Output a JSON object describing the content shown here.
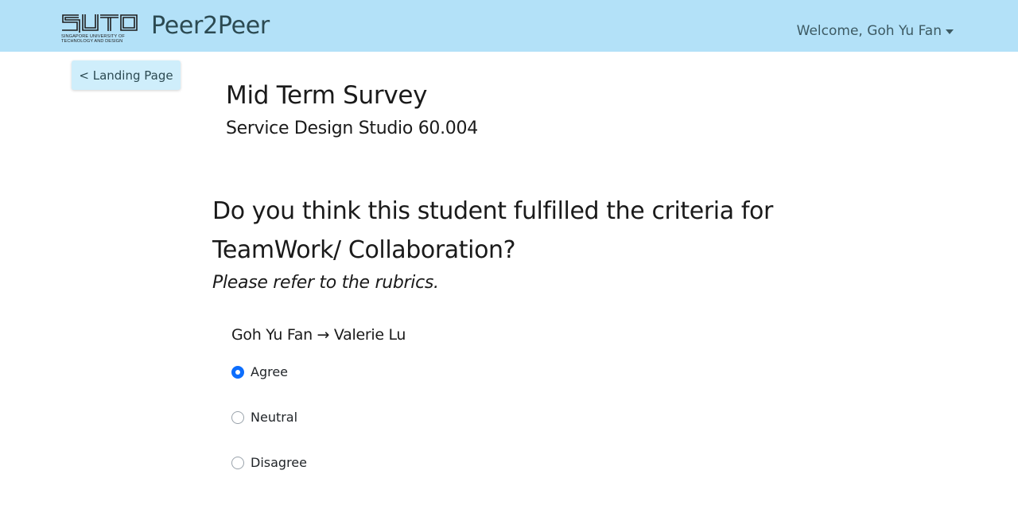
{
  "navbar": {
    "logo_tagline_line1": "SINGAPORE UNIVERSITY OF",
    "logo_tagline_line2": "TECHNOLOGY AND DESIGN",
    "brand": "Peer2Peer",
    "welcome": "Welcome, Goh Yu Fan",
    "colors": {
      "background": "#b3e1f8"
    }
  },
  "back_button": {
    "label": "< Landing Page"
  },
  "survey": {
    "title": "Mid Term Survey",
    "subtitle": "Service Design Studio 60.004"
  },
  "question": {
    "text": "Do you think this student fulfilled the criteria for TeamWork/ Collaboration?",
    "hint": "Please refer to the rubrics."
  },
  "evaluation": {
    "pair": "Goh Yu Fan → Valerie Lu",
    "options": [
      {
        "label": "Agree",
        "checked": true
      },
      {
        "label": "Neutral",
        "checked": false
      },
      {
        "label": "Disagree",
        "checked": false
      }
    ],
    "accent_color": "#0d6efd"
  }
}
